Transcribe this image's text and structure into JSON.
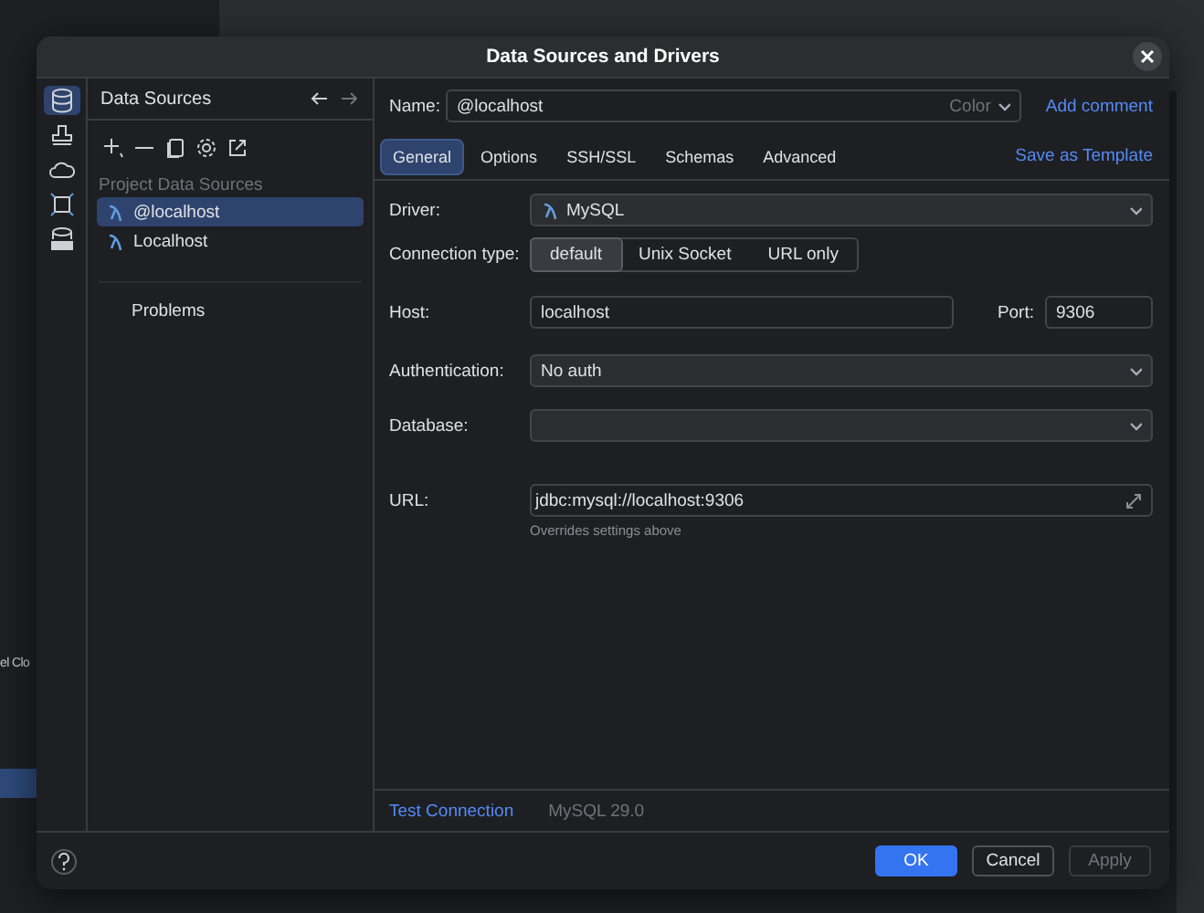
{
  "background": {
    "left_text": "el Clo"
  },
  "dialog": {
    "title": "Data Sources and Drivers"
  },
  "rail": [
    {
      "kind": "database",
      "selected": true
    },
    {
      "kind": "stamp",
      "selected": false
    },
    {
      "kind": "cloud",
      "selected": false
    },
    {
      "kind": "frame",
      "selected": false
    },
    {
      "kind": "ddl",
      "selected": false
    }
  ],
  "sidebar": {
    "title": "Data Sources",
    "section": "Project Data Sources",
    "items": [
      {
        "label": "@localhost",
        "selected": true
      },
      {
        "label": "Localhost",
        "selected": false
      }
    ],
    "problems": "Problems"
  },
  "name_row": {
    "label": "Name:",
    "value": "@localhost",
    "color_label": "Color",
    "link": "Add comment"
  },
  "tabs": [
    {
      "label": "General",
      "selected": true
    },
    {
      "label": "Options",
      "selected": false
    },
    {
      "label": "SSH/SSL",
      "selected": false
    },
    {
      "label": "Schemas",
      "selected": false
    },
    {
      "label": "Advanced",
      "selected": false
    }
  ],
  "save_template": "Save as Template",
  "form": {
    "driver": {
      "label": "Driver:",
      "value": "MySQL"
    },
    "connection_type": {
      "label": "Connection type:",
      "options": [
        {
          "label": "default",
          "selected": true
        },
        {
          "label": "Unix Socket",
          "selected": false
        },
        {
          "label": "URL only",
          "selected": false
        }
      ]
    },
    "host": {
      "label": "Host:",
      "value": "localhost"
    },
    "port": {
      "label": "Port:",
      "value": "9306"
    },
    "authentication": {
      "label": "Authentication:",
      "value": "No auth"
    },
    "database": {
      "label": "Database:"
    },
    "url": {
      "label": "URL:",
      "value": "jdbc:mysql://localhost:9306",
      "hint": "Overrides settings above"
    }
  },
  "footer": {
    "test_connection": "Test Connection",
    "version": "MySQL 29.0"
  },
  "buttons": [
    {
      "label": "OK",
      "kind": "primary",
      "disabled": false
    },
    {
      "label": "Cancel",
      "kind": "default",
      "disabled": false
    },
    {
      "label": "Apply",
      "kind": "default",
      "disabled": true
    }
  ]
}
